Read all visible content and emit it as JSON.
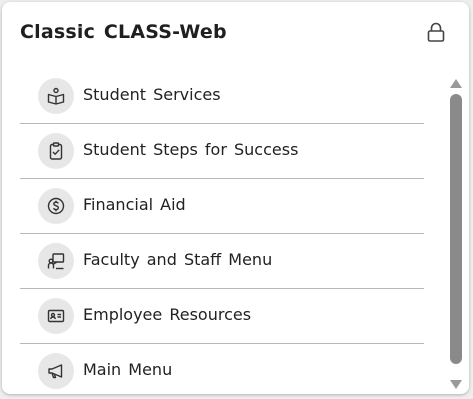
{
  "header": {
    "title": "Classic CLASS-Web",
    "lock_icon": "lock-icon"
  },
  "menu": {
    "items": [
      {
        "label": "Student Services",
        "icon": "open-book-icon"
      },
      {
        "label": "Student Steps for Success",
        "icon": "clipboard-check-icon"
      },
      {
        "label": "Financial Aid",
        "icon": "dollar-circle-icon"
      },
      {
        "label": "Faculty and Staff Menu",
        "icon": "presentation-icon"
      },
      {
        "label": "Employee Resources",
        "icon": "id-card-icon"
      },
      {
        "label": "Main Menu",
        "icon": "megaphone-icon"
      }
    ]
  },
  "colors": {
    "icon_bg": "#e7e7e7",
    "icon_stroke": "#333333",
    "divider": "#b8b8b8",
    "scroll_thumb": "#8a8a8a"
  }
}
